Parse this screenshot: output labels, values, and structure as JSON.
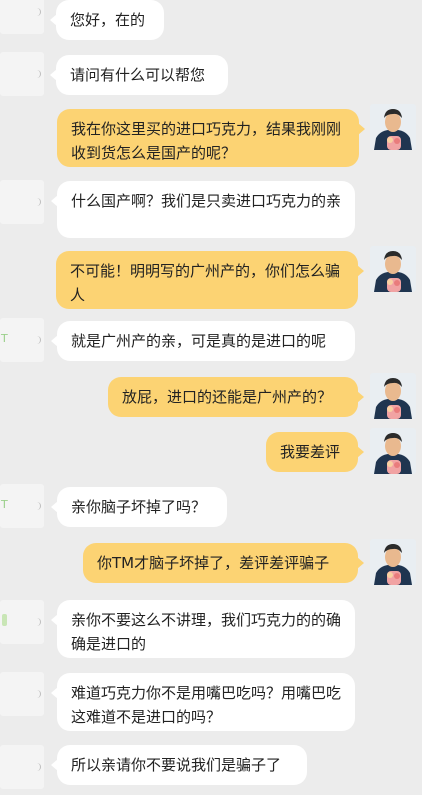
{
  "conversation": {
    "messages": [
      {
        "side": "left",
        "text": "您好，在的"
      },
      {
        "side": "left",
        "text": "请问有什么可以帮您"
      },
      {
        "side": "right",
        "text": "我在你这里买的进口巧克力，结果我刚刚收到货怎么是国产的呢？"
      },
      {
        "side": "left",
        "text": "什么国产啊？我们是只卖进口巧克力的亲"
      },
      {
        "side": "right",
        "text": "不可能！明明写的广州产的，你们怎么骗人"
      },
      {
        "side": "left",
        "text": "就是广州产的亲，可是真的是进口的呢"
      },
      {
        "side": "right",
        "text": "放屁，进口的还能是广州产的？"
      },
      {
        "side": "right",
        "text": "我要差评"
      },
      {
        "side": "left",
        "text": "亲你脑子坏掉了吗？"
      },
      {
        "side": "right",
        "text": "你TM才脑子坏掉了，差评差评骗子"
      },
      {
        "side": "left",
        "text": "亲你不要这么不讲理，我们巧克力的的确确是进口的"
      },
      {
        "side": "left",
        "text": "难道巧克力你不是用嘴巴吃吗？用嘴巴吃这难道不是进口的吗？"
      },
      {
        "side": "left",
        "text": "所以亲请你不要说我们是骗子了"
      }
    ]
  }
}
